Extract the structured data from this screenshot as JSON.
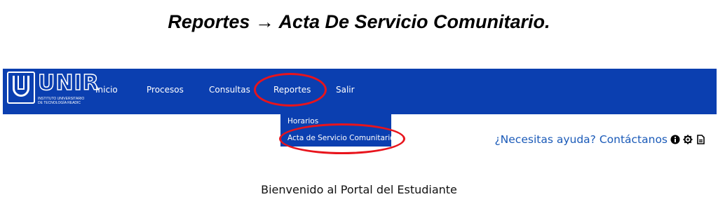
{
  "doc_heading": "Reportes → Acta De Servicio Comunitario.",
  "brand": {
    "name": "UNIR",
    "subtitle": "Instituto Universitario de Tecnología Readic",
    "color": "#0b3fb0"
  },
  "nav": {
    "items": [
      {
        "label": "Inicio"
      },
      {
        "label": "Procesos"
      },
      {
        "label": "Consultas"
      },
      {
        "label": "Reportes"
      },
      {
        "label": "Salir"
      }
    ]
  },
  "dropdown": {
    "items": [
      {
        "label": "Horarios"
      },
      {
        "label": "Acta de Servicio Comunitario"
      }
    ]
  },
  "help": {
    "text": "¿Necesitas ayuda? Contáctanos",
    "icons": [
      "info-icon",
      "gear-icon",
      "file-icon"
    ]
  },
  "welcome": "Bienvenido al Portal del Estudiante",
  "highlight_color": "#e8141c"
}
